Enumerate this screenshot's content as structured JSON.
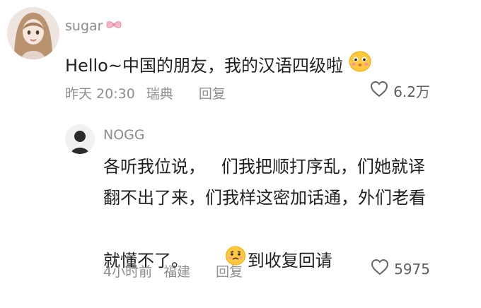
{
  "main_comment": {
    "username": "sugar",
    "text": "Hello~中国的朋友，我的汉语四级啦",
    "time": "昨天 20:30",
    "location": "瑞典",
    "reply_label": "回复",
    "likes": "6.2万"
  },
  "reply_comment": {
    "username": "NOGG",
    "lines": [
      "各听我位说，   们我把顺打序乱，们她就译",
      "翻不出了来，们我样这密加话通，外们老看"
    ],
    "line3_before": "就懂不了。",
    "line3_after": "到收复回请",
    "time": "4小时前",
    "location": "福建",
    "reply_label": "回复",
    "likes": "5975"
  },
  "colors": {
    "text": "#1f1f1f",
    "meta": "#8f8f8f",
    "emoji_yellow": "#ffc83d"
  }
}
